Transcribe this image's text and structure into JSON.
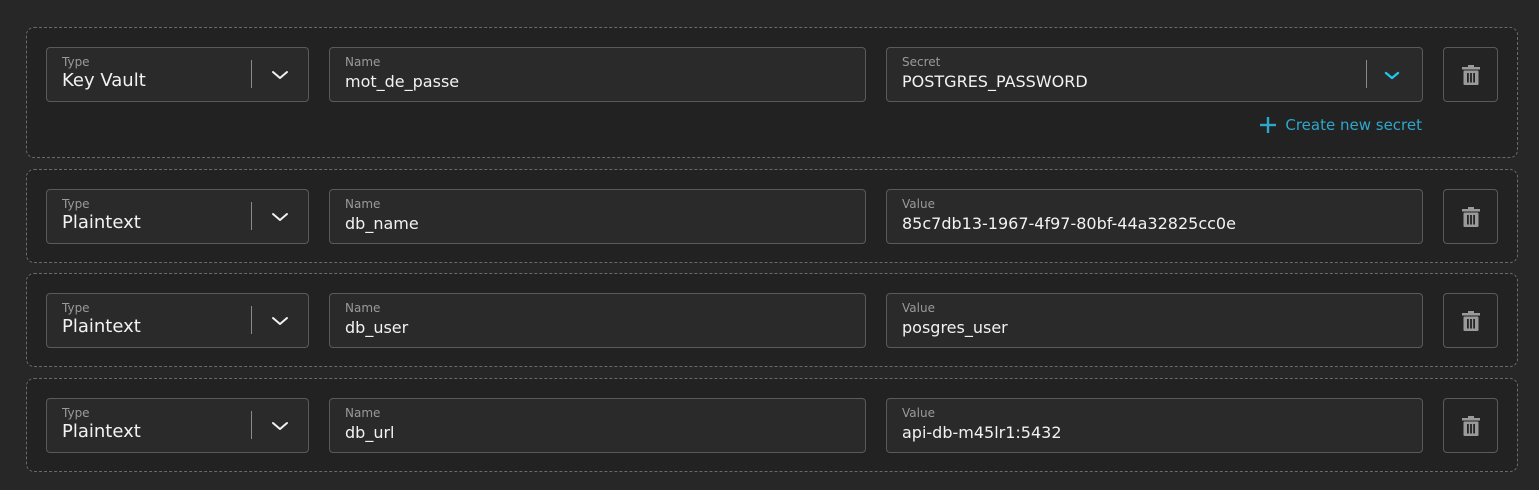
{
  "colors": {
    "accent": "#2fa6cc",
    "chevron_accent": "#1fc7e6",
    "background": "#272727",
    "row_background": "#222222"
  },
  "rows": [
    {
      "type_label": "Type",
      "type_value": "Key Vault",
      "name_label": "Name",
      "name_value": "mot_de_passe",
      "third_label": "Secret",
      "third_value": "POSTGRES_PASSWORD",
      "create_secret_label": "Create new secret"
    },
    {
      "type_label": "Type",
      "type_value": "Plaintext",
      "name_label": "Name",
      "name_value": "db_name",
      "third_label": "Value",
      "third_value": "85c7db13-1967-4f97-80bf-44a32825cc0e"
    },
    {
      "type_label": "Type",
      "type_value": "Plaintext",
      "name_label": "Name",
      "name_value": "db_user",
      "third_label": "Value",
      "third_value": "posgres_user"
    },
    {
      "type_label": "Type",
      "type_value": "Plaintext",
      "name_label": "Name",
      "name_value": "db_url",
      "third_label": "Value",
      "third_value": "api-db-m45lr1:5432"
    }
  ],
  "icons": {
    "type_dropdown": "chevron-down-icon",
    "secret_dropdown": "chevron-down-icon",
    "delete": "trash-icon",
    "add": "plus-icon"
  }
}
